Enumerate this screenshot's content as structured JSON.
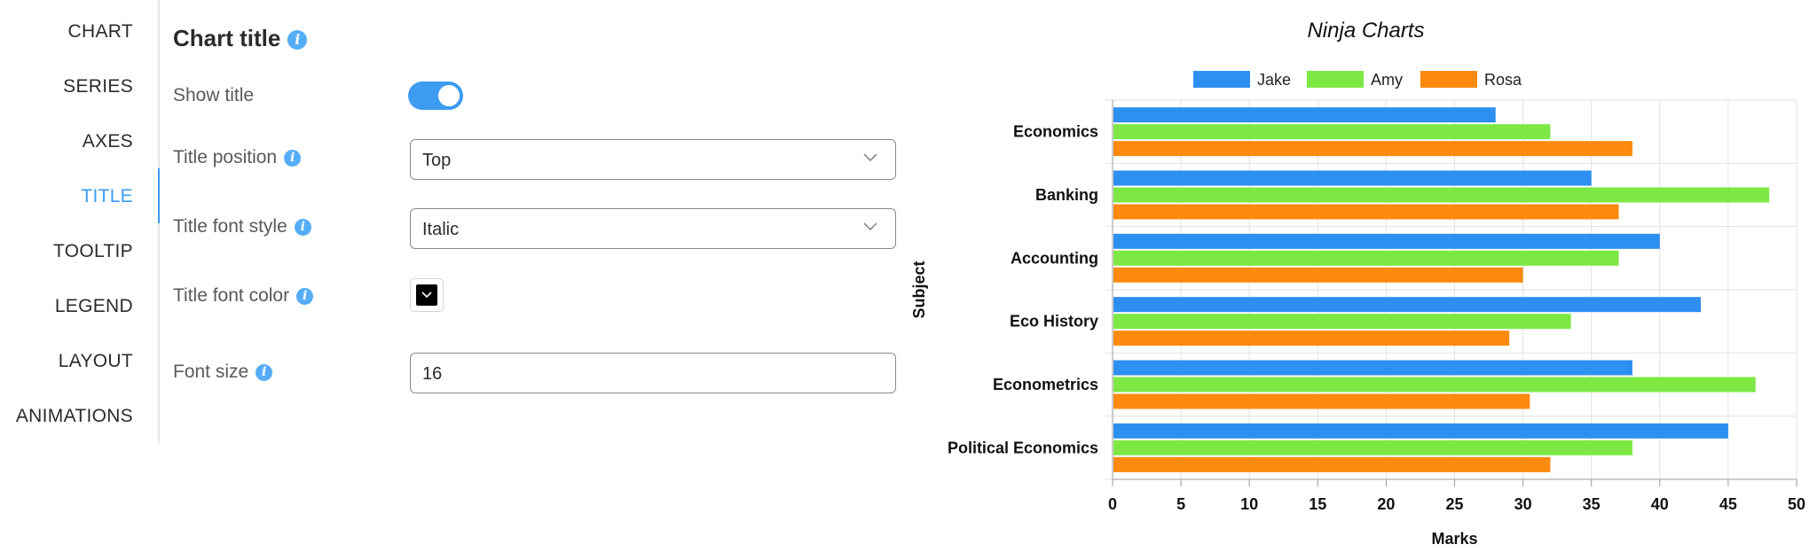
{
  "sidebar": {
    "items": [
      {
        "label": "CHART"
      },
      {
        "label": "SERIES"
      },
      {
        "label": "AXES"
      },
      {
        "label": "TITLE",
        "active": true
      },
      {
        "label": "TOOLTIP"
      },
      {
        "label": "LEGEND"
      },
      {
        "label": "LAYOUT"
      },
      {
        "label": "ANIMATIONS"
      }
    ]
  },
  "panel": {
    "section_title": "Chart title",
    "show_title": {
      "label": "Show title",
      "enabled": true
    },
    "title_position": {
      "label": "Title position",
      "value": "Top"
    },
    "title_font_style": {
      "label": "Title font style",
      "value": "Italic"
    },
    "title_font_color": {
      "label": "Title font color",
      "value": "#000000"
    },
    "font_size": {
      "label": "Font size",
      "value": "16"
    }
  },
  "colors": {
    "accent": "#3b9bf3",
    "toggle_on": "#3d9bf0",
    "info_icon": "#55adf7"
  },
  "chart_data": {
    "type": "bar",
    "orientation": "horizontal",
    "title": "Ninja Charts",
    "title_style": "italic",
    "xlabel": "Marks",
    "ylabel": "Subject",
    "xlim": [
      0,
      50
    ],
    "xticks": [
      "0",
      "5",
      "10",
      "15",
      "20",
      "25",
      "30",
      "35",
      "40",
      "45",
      "50"
    ],
    "grid": true,
    "legend_position": "top",
    "categories": [
      "Economics",
      "Banking",
      "Accounting",
      "Eco History",
      "Econometrics",
      "Political Economics"
    ],
    "series": [
      {
        "name": "Jake",
        "color": "#2d8ff0",
        "values": [
          28,
          35,
          40,
          43,
          38,
          45
        ]
      },
      {
        "name": "Amy",
        "color": "#7de843",
        "values": [
          32,
          48,
          37,
          33.5,
          47,
          38
        ]
      },
      {
        "name": "Rosa",
        "color": "#fb8a0f",
        "values": [
          38,
          37,
          30,
          29,
          30.5,
          32
        ]
      }
    ]
  }
}
